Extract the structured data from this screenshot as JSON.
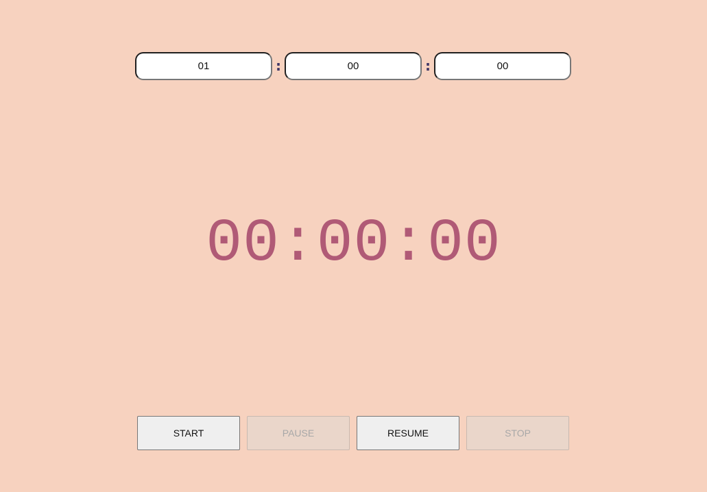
{
  "timer_inputs": {
    "hours": "01",
    "minutes": "00",
    "seconds": "00",
    "separator": ":"
  },
  "display": {
    "time": "00:00:00",
    "color": "#b05a76"
  },
  "buttons": {
    "start": "START",
    "pause": "PAUSE",
    "resume": "RESUME",
    "stop": "STOP"
  },
  "colors": {
    "background": "#f7d2bf",
    "separator": "#3d3566"
  }
}
